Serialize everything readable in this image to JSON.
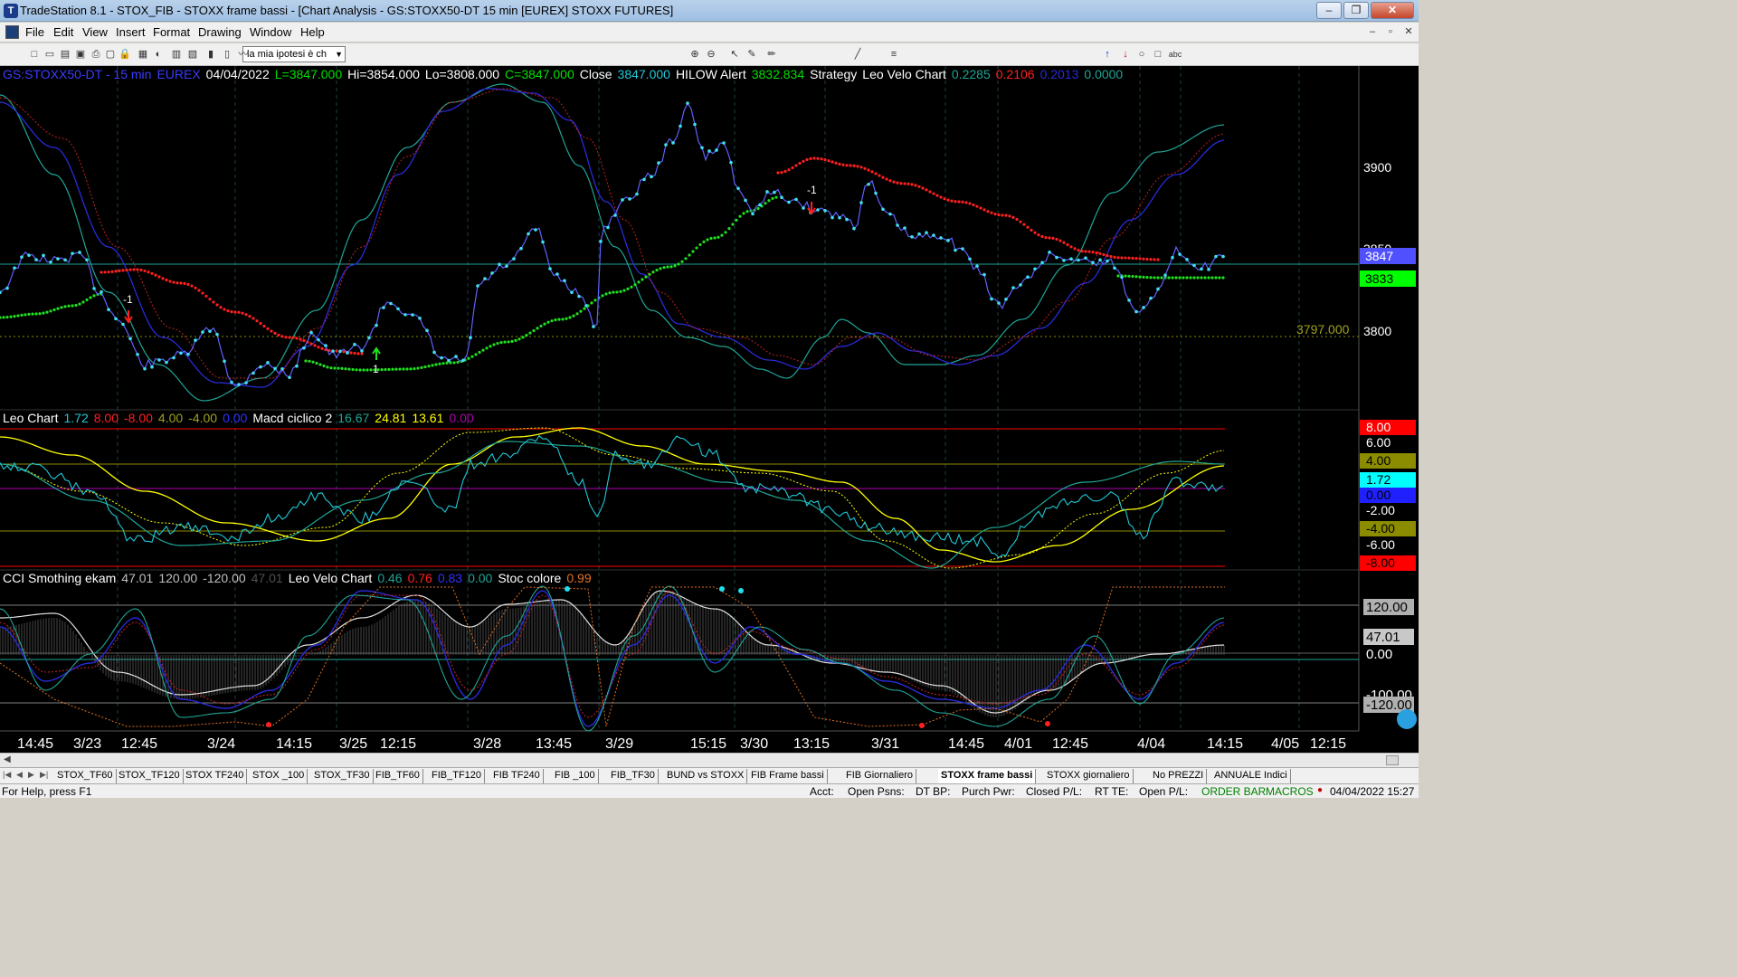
{
  "window": {
    "title": "TradeStation 8.1 - STOX_FIB - STOXX frame bassi - [Chart Analysis - GS:STOXX50-DT  15 min  [EUREX] STOXX FUTURES]",
    "minimize": "‒",
    "restore": "❐",
    "close": "✕"
  },
  "menu": {
    "items": [
      "File",
      "Edit",
      "View",
      "Insert",
      "Format",
      "Drawing",
      "Window",
      "Help"
    ],
    "mdi": [
      "‒",
      "▫",
      "✕"
    ]
  },
  "toolbar": {
    "combo_value": "la mia ipotesi è ch",
    "icons": [
      "new-icon",
      "open-icon",
      "open-workspace-icon",
      "save-icon",
      "print-icon",
      "preview-icon",
      "lock-icon",
      "chart-window-icon",
      "color-icon",
      "insert-indicator-icon",
      "format-icon",
      "bar-chart-icon",
      "candle-icon",
      "line-chart-icon",
      "zoom-in-icon",
      "zoom-out-icon",
      "pointer-icon",
      "tool-icon",
      "drawing-icon",
      "trendline-icon",
      "fib-icon",
      "arrow-up-icon",
      "arrow-down-icon",
      "ellipse-icon",
      "rectangle-icon",
      "text-icon"
    ]
  },
  "panes": {
    "price": {
      "legend": [
        {
          "text": "GS:STOXX50-DT - 15 min",
          "color": "#3c3cff"
        },
        {
          "text": "EUREX",
          "color": "#3c3cff"
        },
        {
          "text": "04/04/2022",
          "color": "#ffffff"
        },
        {
          "text": "L=3847.000",
          "color": "#00e000"
        },
        {
          "text": "Hi=3854.000",
          "color": "#ffffff"
        },
        {
          "text": "Lo=3808.000",
          "color": "#ffffff"
        },
        {
          "text": "C=3847.000",
          "color": "#00e000"
        },
        {
          "text": "Close",
          "color": "#ffffff"
        },
        {
          "text": "3847.000",
          "color": "#20c8d8"
        },
        {
          "text": "HILOW Alert",
          "color": "#ffffff"
        },
        {
          "text": "3832.834",
          "color": "#00e000"
        },
        {
          "text": "Strategy",
          "color": "#ffffff"
        },
        {
          "text": "Leo Velo Chart",
          "color": "#ffffff"
        },
        {
          "text": "0.2285",
          "color": "#1fa596"
        },
        {
          "text": "0.2106",
          "color": "#ff2020"
        },
        {
          "text": "0.2013",
          "color": "#2a2ad8"
        },
        {
          "text": "0.0000",
          "color": "#1fa596"
        }
      ],
      "axis_labels": [
        "3900",
        "3850",
        "3800"
      ],
      "last_price": "3847",
      "hilow_value": "3833",
      "level_label": "3797.000",
      "signals": [
        "-1",
        "1",
        "-1"
      ]
    },
    "leo": {
      "legend": [
        {
          "text": "Leo Chart",
          "color": "#ffffff"
        },
        {
          "text": "1.72",
          "color": "#20c8d8"
        },
        {
          "text": "8.00",
          "color": "#ff2020"
        },
        {
          "text": "-8.00",
          "color": "#ff2020"
        },
        {
          "text": "4.00",
          "color": "#a0a020"
        },
        {
          "text": "-4.00",
          "color": "#a0a020"
        },
        {
          "text": "0.00",
          "color": "#3030ff"
        },
        {
          "text": "Macd ciclico 2",
          "color": "#ffffff"
        },
        {
          "text": "16.67",
          "color": "#1fa596"
        },
        {
          "text": "24.81",
          "color": "#ffff00"
        },
        {
          "text": "13.61",
          "color": "#ffff00"
        },
        {
          "text": "0.00",
          "color": "#b000b0"
        }
      ],
      "axis_tags": [
        {
          "text": "8.00",
          "bg": "#ff0000",
          "fg": "#ffffff"
        },
        {
          "text": "6.00",
          "bg": "#000000",
          "fg": "#ffffff"
        },
        {
          "text": "4.00",
          "bg": "#8c8c00",
          "fg": "#000000"
        },
        {
          "text": "1.72",
          "bg": "#00ffff",
          "fg": "#000000"
        },
        {
          "text": "0.00",
          "bg": "#2020ff",
          "fg": "#000000"
        },
        {
          "text": "-2.00",
          "bg": "#000000",
          "fg": "#ffffff"
        },
        {
          "text": "-4.00",
          "bg": "#8c8c00",
          "fg": "#000000"
        },
        {
          "text": "-6.00",
          "bg": "#000000",
          "fg": "#ffffff"
        },
        {
          "text": "-8.00",
          "bg": "#ff0000",
          "fg": "#000000"
        }
      ]
    },
    "cci": {
      "legend": [
        {
          "text": "CCI Smothing ekam",
          "color": "#ffffff"
        },
        {
          "text": "47.01",
          "color": "#c0c0c0"
        },
        {
          "text": "120.00",
          "color": "#c0c0c0"
        },
        {
          "text": "-120.00",
          "color": "#c0c0c0"
        },
        {
          "text": "47.01",
          "color": "#505050"
        },
        {
          "text": "Leo Velo Chart",
          "color": "#ffffff"
        },
        {
          "text": "0.46",
          "color": "#1fa596"
        },
        {
          "text": "0.76",
          "color": "#ff2020"
        },
        {
          "text": "0.83",
          "color": "#3030ff"
        },
        {
          "text": "0.00",
          "color": "#1fa596"
        },
        {
          "text": "Stoc colore",
          "color": "#ffffff"
        },
        {
          "text": "0.99",
          "color": "#e07020"
        }
      ],
      "axis_tags": [
        {
          "text": "120.00",
          "bg": "#b0b0b0",
          "fg": "#000000"
        },
        {
          "text": "47.01",
          "bg": "#c8c8c8",
          "fg": "#000000"
        },
        {
          "text": "0.00",
          "bg": "#000000",
          "fg": "#ffffff"
        },
        {
          "text": "-100.00",
          "bg": "#000000",
          "fg": "#ffffff"
        },
        {
          "text": "-120.00",
          "bg": "#b0b0b0",
          "fg": "#000000"
        }
      ]
    }
  },
  "time_axis": [
    "14:45",
    "3/23",
    "12:45",
    "3/24",
    "14:15",
    "3/25",
    "12:15",
    "3/28",
    "13:45",
    "3/29",
    "15:15",
    "3/30",
    "13:15",
    "3/31",
    "14:45",
    "4/01",
    "12:45",
    "4/04",
    "14:15",
    "4/05",
    "12:15"
  ],
  "sheet_tabs": [
    "STOX_TF60",
    "STOX_TF120",
    "STOX TF240",
    "STOX _100",
    "STOX_TF30",
    "FIB_TF60",
    "FIB_TF120",
    "FIB TF240",
    "FIB _100",
    "FIB_TF30",
    "BUND vs STOXX",
    "FIB Frame bassi",
    "FIB Giornaliero",
    "STOXX frame bassi",
    "STOXX giornaliero",
    "No PREZZI",
    "ANNUALE Indici"
  ],
  "active_tab": "STOXX frame bassi",
  "status": {
    "help": "For Help, press F1",
    "acct": "Acct:",
    "open_psns": "Open Psns:",
    "dt_bp": "DT BP:",
    "purch_pwr": "Purch Pwr:",
    "closed_pl": "Closed P/L:",
    "rt_te": "RT TE:",
    "open_pl": "Open P/L:",
    "order_bar": "ORDER BAR",
    "macros": "MACROS",
    "datetime": "04/04/2022 15:27"
  },
  "colors": {
    "price_line": "#6060ff",
    "price_dots": "#40e0f0",
    "band_red": "#ff2020",
    "band_green": "#20e020",
    "teal": "#1fa596",
    "navy": "#2a2ad8",
    "yellow": "#ffff00"
  }
}
